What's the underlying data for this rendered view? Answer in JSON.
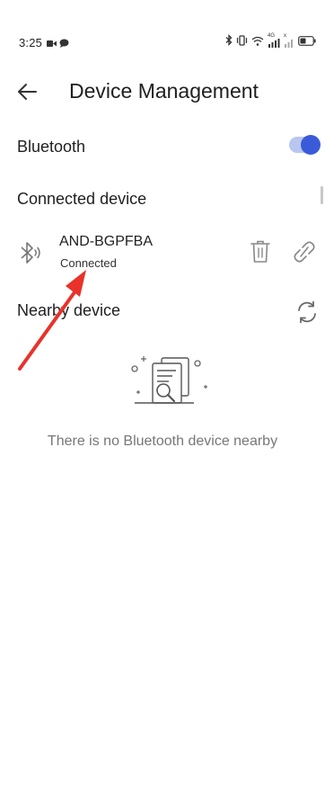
{
  "status_bar": {
    "time": "3:25",
    "left_icons": [
      "video-icon",
      "chat-bubble-icon"
    ],
    "right_icons": [
      "bluetooth-icon",
      "vibrate-icon",
      "wifi-icon",
      "signal-4g-icon",
      "signal-x-icon",
      "battery-icon"
    ],
    "signal_label_1": "4G",
    "signal_label_2": "x"
  },
  "header": {
    "title": "Device Management",
    "back_icon": "arrow-left-icon"
  },
  "bluetooth": {
    "label": "Bluetooth",
    "enabled": true,
    "accent_color": "#3a5bd9"
  },
  "connected_section": {
    "title": "Connected device",
    "devices": [
      {
        "name": "AND-BGPFBA",
        "status": "Connected",
        "icon": "bluetooth-audio-icon",
        "actions": [
          "delete-icon",
          "unlink-icon"
        ]
      }
    ]
  },
  "nearby_section": {
    "title": "Nearby device",
    "refresh_icon": "refresh-icon",
    "empty_icon": "document-search-icon",
    "empty_text": "There is no Bluetooth device nearby"
  },
  "annotation": {
    "color": "#e8322a"
  }
}
